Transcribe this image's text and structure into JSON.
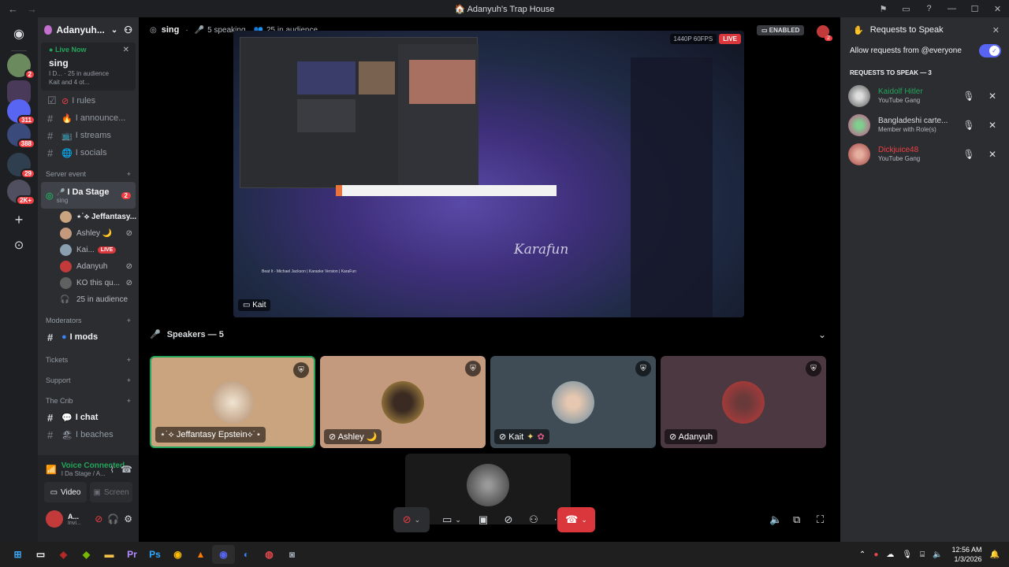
{
  "window": {
    "title": "Adanyuh's Trap House"
  },
  "guild_badges": {
    "g1": "2",
    "g3": "311",
    "g4": "388",
    "g5": "29",
    "g6": "2K+"
  },
  "server": {
    "name": "Adanyuh..."
  },
  "live_now": {
    "tag": "Live Now",
    "name": "sing",
    "sub1": "I D... · 25 in audience",
    "sub2": "Kait and 4 ot..."
  },
  "channels": [
    {
      "label": "I rules"
    },
    {
      "label": "I announce..."
    },
    {
      "label": "I streams"
    },
    {
      "label": "I socials"
    }
  ],
  "categories": {
    "server_event": "Server event",
    "moderators": "Moderators",
    "tickets": "Tickets",
    "support": "Support",
    "crib": "The Crib"
  },
  "stage": {
    "name": "I Da Stage",
    "topic": "sing",
    "badge": "2"
  },
  "stage_users": [
    {
      "name": "⋆˙⟡ Jeffantasy..."
    },
    {
      "name": "Ashley 🌙"
    },
    {
      "name": "Kai..."
    },
    {
      "name": "Adanyuh"
    },
    {
      "name": "KO this qu..."
    }
  ],
  "live_label": "LIVE",
  "audience_count": "25 in audience",
  "mods_channel": "I mods",
  "chat_channel": "I chat",
  "beaches_channel": "I beaches",
  "voice": {
    "status": "Voice Connected",
    "location": "I Da Stage / A...",
    "video_label": "Video",
    "screen_label": "Screen"
  },
  "user_panel": {
    "name": "A...",
    "status": "Invi..."
  },
  "header": {
    "channel": "sing",
    "speaking": "5 speaking",
    "audience": "25 in audience",
    "enabled": "ENABLED",
    "notif": "2"
  },
  "stream": {
    "quality": "1440P 60FPS",
    "live": "LIVE",
    "owner_tag": "Kait",
    "video_title": "Beat It - Michael Jackson | Karaoke Version | KaraFun",
    "watermark": "Karafun"
  },
  "speakers": {
    "header": "Speakers — 5",
    "tiles": [
      {
        "name": "⋆˙⟡ Jeffantasy Epstein⟡˙⋆",
        "bg": "#c9a47e"
      },
      {
        "name": "Ashley 🌙",
        "bg": "#c49a7e"
      },
      {
        "name": "Kait",
        "bg": "#3f4c55"
      },
      {
        "name": "Adanyuh",
        "bg": "#4b3840"
      }
    ]
  },
  "requests": {
    "title": "Requests to Speak",
    "allow_label": "Allow requests from @everyone",
    "section": "REQUESTS TO SPEAK — 3",
    "items": [
      {
        "name": "Kaidolf Hitler",
        "sub": "YouTube Gang",
        "color": "#23a55a"
      },
      {
        "name": "Bangladeshi carte...",
        "sub": "Member with Role(s)",
        "color": "#dbdee1"
      },
      {
        "name": "Dickjuice48",
        "sub": "YouTube Gang",
        "color": "#f23f43"
      }
    ]
  },
  "clock": {
    "time": "12:56 AM",
    "date": "1/3/2026"
  }
}
